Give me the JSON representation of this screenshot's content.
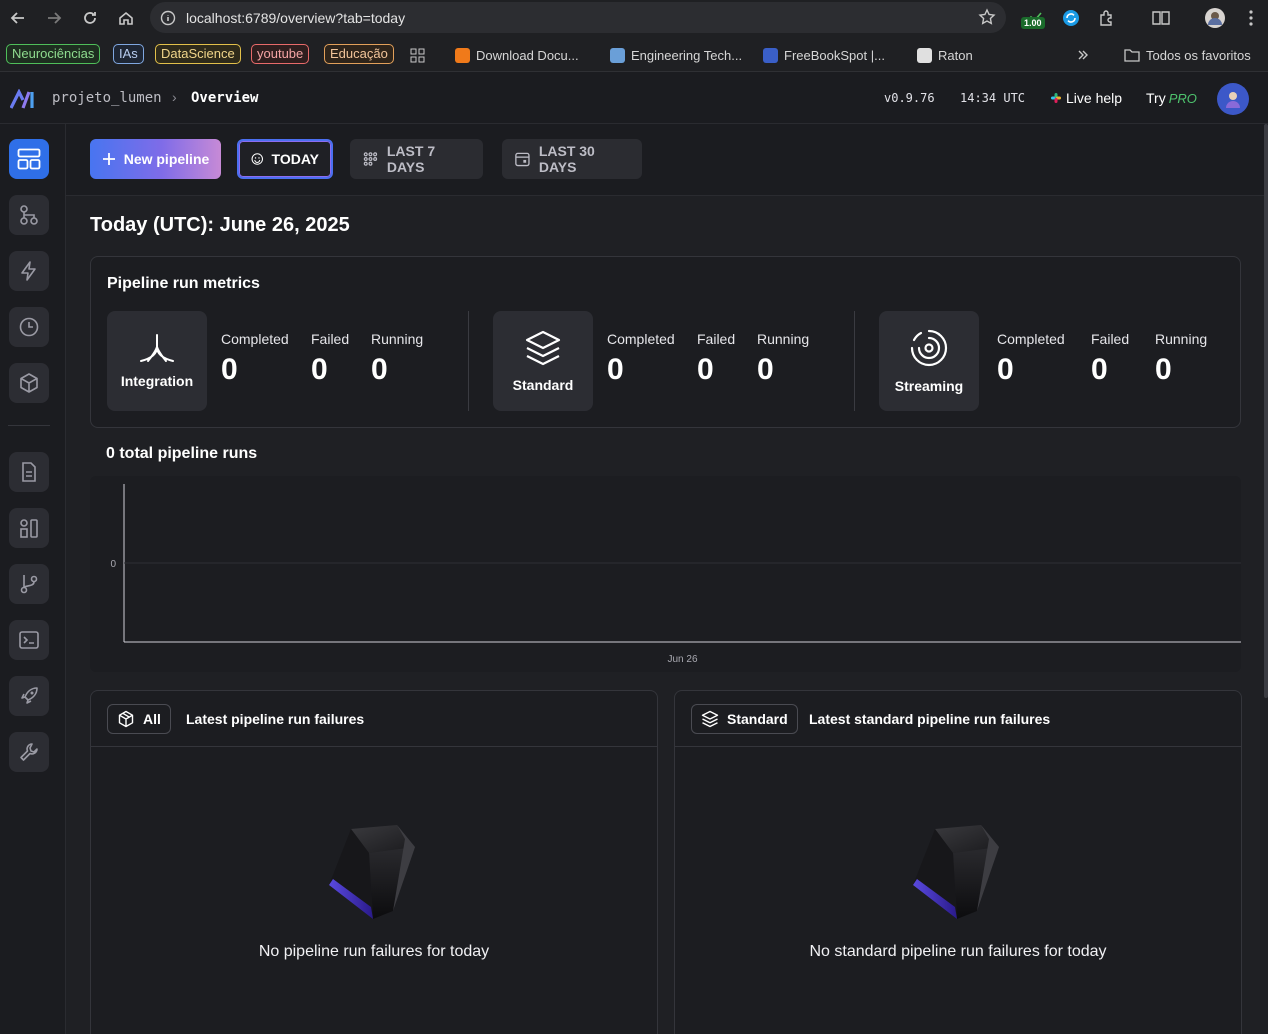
{
  "browser": {
    "url": "localhost:6789/overview?tab=today",
    "extension_badge": "1.00",
    "bookmarks": {
      "chips": [
        {
          "label": "Neurociências",
          "color": "#4fbf5a"
        },
        {
          "label": "IAs",
          "color": "#7fa7e0"
        },
        {
          "label": "DataScience",
          "color": "#e2c04a"
        },
        {
          "label": "youtube",
          "color": "#e86a6a"
        },
        {
          "label": "Educação",
          "color": "#e2a05a"
        }
      ],
      "links": [
        "Download Docu...",
        "Engineering Tech...",
        "FreeBookSpot |...",
        "Raton"
      ],
      "all_bookmarks": "Todos os favoritos"
    }
  },
  "header": {
    "project": "projeto_lumen",
    "separator": "›",
    "page": "Overview",
    "version": "v0.9.76",
    "time": "14:34 UTC",
    "help": "Live help",
    "try": "Try",
    "pro": "PRO"
  },
  "toolbar": {
    "new_pipeline": "New pipeline",
    "tabs": [
      "TODAY",
      "LAST 7 DAYS",
      "LAST 30 DAYS"
    ]
  },
  "page_title": "Today (UTC): June 26, 2025",
  "metrics": {
    "title": "Pipeline run metrics",
    "groups": [
      {
        "name": "Integration",
        "completed": "0",
        "failed": "0",
        "running": "0"
      },
      {
        "name": "Standard",
        "completed": "0",
        "failed": "0",
        "running": "0"
      },
      {
        "name": "Streaming",
        "completed": "0",
        "failed": "0",
        "running": "0"
      }
    ],
    "labels": {
      "completed": "Completed",
      "failed": "Failed",
      "running": "Running"
    }
  },
  "runs_title": "0 total pipeline runs",
  "chart_data": {
    "type": "bar",
    "categories": [
      "Jun 26"
    ],
    "values": [
      0
    ],
    "title": "0 total pipeline runs",
    "xlabel": "",
    "ylabel": "",
    "yticks": [
      "0"
    ]
  },
  "failures": {
    "left": {
      "chip": "All",
      "title": "Latest pipeline run failures",
      "empty": "No pipeline run failures for today"
    },
    "right": {
      "chip": "Standard",
      "title": "Latest standard pipeline run failures",
      "empty": "No standard pipeline run failures for today"
    }
  }
}
